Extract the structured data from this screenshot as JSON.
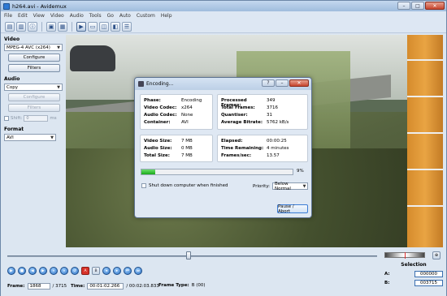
{
  "window": {
    "title": "h264.avi - Avidemux",
    "min": "–",
    "max": "□",
    "close": "✕"
  },
  "menu": [
    "File",
    "Edit",
    "View",
    "Video",
    "Audio",
    "Tools",
    "Go",
    "Auto",
    "Custom",
    "Help"
  ],
  "toolbar": [
    "open-icon",
    "save-icon",
    "info-icon",
    "preview-icon",
    "output-icon",
    "playback-icon",
    "input-view-icon",
    "output-view-icon",
    "side-by-side-icon",
    "mixed-view-icon"
  ],
  "sidebar": {
    "video_label": "Video",
    "video_codec": "MPEG-4 AVC (x264)",
    "video_configure": "Configure",
    "video_filters": "Filters",
    "audio_label": "Audio",
    "audio_codec": "Copy",
    "audio_configure": "Configure",
    "audio_filters": "Filters",
    "shift_label": "Shift:",
    "shift_value": "0",
    "shift_unit": "ms",
    "format_label": "Format",
    "format_value": "AVI"
  },
  "dialog": {
    "title": "Encoding...",
    "help_btn": "?",
    "min_btn": "–",
    "close_btn": "✕",
    "left_info": [
      {
        "k": "Phase:",
        "v": "Encoding"
      },
      {
        "k": "Video Codec:",
        "v": "x264"
      },
      {
        "k": "Audio Codec:",
        "v": "None"
      },
      {
        "k": "Container:",
        "v": "AVI"
      }
    ],
    "right_info": [
      {
        "k": "Processed Frames:",
        "v": "349"
      },
      {
        "k": "Total Frames:",
        "v": "3716"
      },
      {
        "k": "Quantiser:",
        "v": "31"
      },
      {
        "k": "Average Bitrate:",
        "v": "5762 kB/s"
      }
    ],
    "left_size": [
      {
        "k": "Video Size:",
        "v": "7 MB"
      },
      {
        "k": "Audio Size:",
        "v": "0 MB"
      },
      {
        "k": "Total Size:",
        "v": "7 MB"
      }
    ],
    "right_time": [
      {
        "k": "Elapsed:",
        "v": "00:00:25"
      },
      {
        "k": "Time Remaining:",
        "v": "4 minutes"
      },
      {
        "k": "Frames/sec:",
        "v": "13.57"
      }
    ],
    "progress_fraction": 0.09,
    "progress_text": "9%",
    "shutdown_label": "Shut down computer when finished",
    "priority_label": "Priority:",
    "priority_value": "Below Normal",
    "pause_label": "Pause / Abort"
  },
  "player": {
    "controls": [
      "play-icon",
      "stop-icon",
      "prev-frame-icon",
      "next-frame-icon",
      "prev-keyframe-icon",
      "next-keyframe-icon",
      "rewind-icon",
      "set-marker-a-icon",
      "set-marker-b-icon",
      "prev-black-icon",
      "next-black-icon",
      "first-frame-icon",
      "last-frame-icon"
    ],
    "frame_label": "Frame:",
    "frame_value": "1868",
    "frame_total": "/ 3715",
    "time_label": "Time:",
    "time_value": "00:01:02.266",
    "time_total": "/ 00:02:03.833",
    "frametype_label": "Frame Type:",
    "frametype_value": "B (00)"
  },
  "selection": {
    "title": "Selection",
    "a_label": "A:",
    "a_value": "000000",
    "b_label": "B:",
    "b_value": "003715"
  }
}
